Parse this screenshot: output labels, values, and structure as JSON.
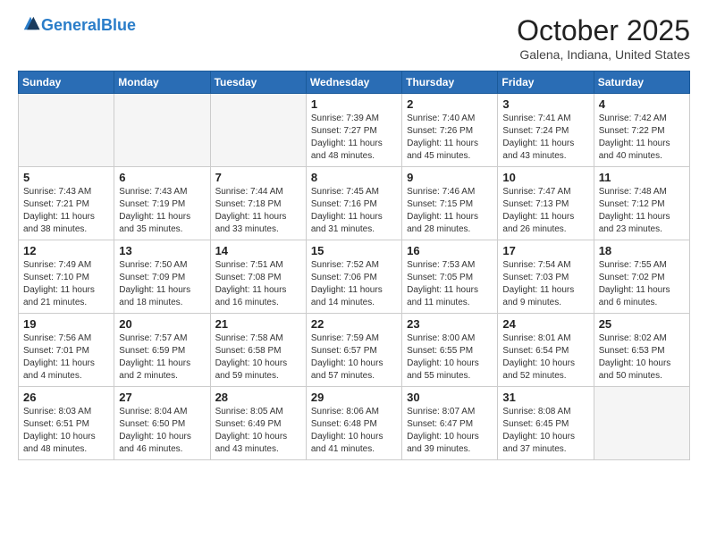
{
  "header": {
    "logo_line1": "General",
    "logo_line2": "Blue",
    "month": "October 2025",
    "location": "Galena, Indiana, United States"
  },
  "weekdays": [
    "Sunday",
    "Monday",
    "Tuesday",
    "Wednesday",
    "Thursday",
    "Friday",
    "Saturday"
  ],
  "weeks": [
    [
      {
        "day": "",
        "sunrise": "",
        "sunset": "",
        "daylight": "",
        "empty": true
      },
      {
        "day": "",
        "sunrise": "",
        "sunset": "",
        "daylight": "",
        "empty": true
      },
      {
        "day": "",
        "sunrise": "",
        "sunset": "",
        "daylight": "",
        "empty": true
      },
      {
        "day": "1",
        "sunrise": "Sunrise: 7:39 AM",
        "sunset": "Sunset: 7:27 PM",
        "daylight": "Daylight: 11 hours and 48 minutes.",
        "empty": false
      },
      {
        "day": "2",
        "sunrise": "Sunrise: 7:40 AM",
        "sunset": "Sunset: 7:26 PM",
        "daylight": "Daylight: 11 hours and 45 minutes.",
        "empty": false
      },
      {
        "day": "3",
        "sunrise": "Sunrise: 7:41 AM",
        "sunset": "Sunset: 7:24 PM",
        "daylight": "Daylight: 11 hours and 43 minutes.",
        "empty": false
      },
      {
        "day": "4",
        "sunrise": "Sunrise: 7:42 AM",
        "sunset": "Sunset: 7:22 PM",
        "daylight": "Daylight: 11 hours and 40 minutes.",
        "empty": false
      }
    ],
    [
      {
        "day": "5",
        "sunrise": "Sunrise: 7:43 AM",
        "sunset": "Sunset: 7:21 PM",
        "daylight": "Daylight: 11 hours and 38 minutes.",
        "empty": false
      },
      {
        "day": "6",
        "sunrise": "Sunrise: 7:43 AM",
        "sunset": "Sunset: 7:19 PM",
        "daylight": "Daylight: 11 hours and 35 minutes.",
        "empty": false
      },
      {
        "day": "7",
        "sunrise": "Sunrise: 7:44 AM",
        "sunset": "Sunset: 7:18 PM",
        "daylight": "Daylight: 11 hours and 33 minutes.",
        "empty": false
      },
      {
        "day": "8",
        "sunrise": "Sunrise: 7:45 AM",
        "sunset": "Sunset: 7:16 PM",
        "daylight": "Daylight: 11 hours and 31 minutes.",
        "empty": false
      },
      {
        "day": "9",
        "sunrise": "Sunrise: 7:46 AM",
        "sunset": "Sunset: 7:15 PM",
        "daylight": "Daylight: 11 hours and 28 minutes.",
        "empty": false
      },
      {
        "day": "10",
        "sunrise": "Sunrise: 7:47 AM",
        "sunset": "Sunset: 7:13 PM",
        "daylight": "Daylight: 11 hours and 26 minutes.",
        "empty": false
      },
      {
        "day": "11",
        "sunrise": "Sunrise: 7:48 AM",
        "sunset": "Sunset: 7:12 PM",
        "daylight": "Daylight: 11 hours and 23 minutes.",
        "empty": false
      }
    ],
    [
      {
        "day": "12",
        "sunrise": "Sunrise: 7:49 AM",
        "sunset": "Sunset: 7:10 PM",
        "daylight": "Daylight: 11 hours and 21 minutes.",
        "empty": false
      },
      {
        "day": "13",
        "sunrise": "Sunrise: 7:50 AM",
        "sunset": "Sunset: 7:09 PM",
        "daylight": "Daylight: 11 hours and 18 minutes.",
        "empty": false
      },
      {
        "day": "14",
        "sunrise": "Sunrise: 7:51 AM",
        "sunset": "Sunset: 7:08 PM",
        "daylight": "Daylight: 11 hours and 16 minutes.",
        "empty": false
      },
      {
        "day": "15",
        "sunrise": "Sunrise: 7:52 AM",
        "sunset": "Sunset: 7:06 PM",
        "daylight": "Daylight: 11 hours and 14 minutes.",
        "empty": false
      },
      {
        "day": "16",
        "sunrise": "Sunrise: 7:53 AM",
        "sunset": "Sunset: 7:05 PM",
        "daylight": "Daylight: 11 hours and 11 minutes.",
        "empty": false
      },
      {
        "day": "17",
        "sunrise": "Sunrise: 7:54 AM",
        "sunset": "Sunset: 7:03 PM",
        "daylight": "Daylight: 11 hours and 9 minutes.",
        "empty": false
      },
      {
        "day": "18",
        "sunrise": "Sunrise: 7:55 AM",
        "sunset": "Sunset: 7:02 PM",
        "daylight": "Daylight: 11 hours and 6 minutes.",
        "empty": false
      }
    ],
    [
      {
        "day": "19",
        "sunrise": "Sunrise: 7:56 AM",
        "sunset": "Sunset: 7:01 PM",
        "daylight": "Daylight: 11 hours and 4 minutes.",
        "empty": false
      },
      {
        "day": "20",
        "sunrise": "Sunrise: 7:57 AM",
        "sunset": "Sunset: 6:59 PM",
        "daylight": "Daylight: 11 hours and 2 minutes.",
        "empty": false
      },
      {
        "day": "21",
        "sunrise": "Sunrise: 7:58 AM",
        "sunset": "Sunset: 6:58 PM",
        "daylight": "Daylight: 10 hours and 59 minutes.",
        "empty": false
      },
      {
        "day": "22",
        "sunrise": "Sunrise: 7:59 AM",
        "sunset": "Sunset: 6:57 PM",
        "daylight": "Daylight: 10 hours and 57 minutes.",
        "empty": false
      },
      {
        "day": "23",
        "sunrise": "Sunrise: 8:00 AM",
        "sunset": "Sunset: 6:55 PM",
        "daylight": "Daylight: 10 hours and 55 minutes.",
        "empty": false
      },
      {
        "day": "24",
        "sunrise": "Sunrise: 8:01 AM",
        "sunset": "Sunset: 6:54 PM",
        "daylight": "Daylight: 10 hours and 52 minutes.",
        "empty": false
      },
      {
        "day": "25",
        "sunrise": "Sunrise: 8:02 AM",
        "sunset": "Sunset: 6:53 PM",
        "daylight": "Daylight: 10 hours and 50 minutes.",
        "empty": false
      }
    ],
    [
      {
        "day": "26",
        "sunrise": "Sunrise: 8:03 AM",
        "sunset": "Sunset: 6:51 PM",
        "daylight": "Daylight: 10 hours and 48 minutes.",
        "empty": false
      },
      {
        "day": "27",
        "sunrise": "Sunrise: 8:04 AM",
        "sunset": "Sunset: 6:50 PM",
        "daylight": "Daylight: 10 hours and 46 minutes.",
        "empty": false
      },
      {
        "day": "28",
        "sunrise": "Sunrise: 8:05 AM",
        "sunset": "Sunset: 6:49 PM",
        "daylight": "Daylight: 10 hours and 43 minutes.",
        "empty": false
      },
      {
        "day": "29",
        "sunrise": "Sunrise: 8:06 AM",
        "sunset": "Sunset: 6:48 PM",
        "daylight": "Daylight: 10 hours and 41 minutes.",
        "empty": false
      },
      {
        "day": "30",
        "sunrise": "Sunrise: 8:07 AM",
        "sunset": "Sunset: 6:47 PM",
        "daylight": "Daylight: 10 hours and 39 minutes.",
        "empty": false
      },
      {
        "day": "31",
        "sunrise": "Sunrise: 8:08 AM",
        "sunset": "Sunset: 6:45 PM",
        "daylight": "Daylight: 10 hours and 37 minutes.",
        "empty": false
      },
      {
        "day": "",
        "sunrise": "",
        "sunset": "",
        "daylight": "",
        "empty": true
      }
    ]
  ]
}
